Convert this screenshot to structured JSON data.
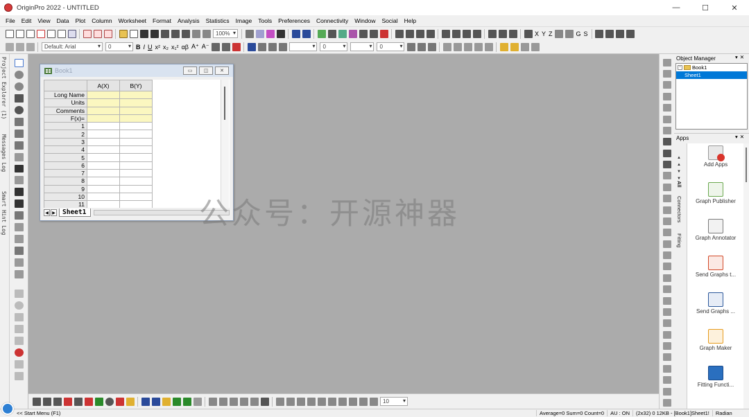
{
  "window": {
    "title": "OriginPro 2022 - UNTITLED",
    "controls": [
      "—",
      "☐",
      "✕"
    ]
  },
  "menu": [
    "File",
    "Edit",
    "View",
    "Data",
    "Plot",
    "Column",
    "Worksheet",
    "Format",
    "Analysis",
    "Statistics",
    "Image",
    "Tools",
    "Preferences",
    "Connectivity",
    "Window",
    "Social",
    "Help"
  ],
  "toolbar": {
    "zoom": "100%",
    "font_name": "Default: Arial",
    "font_size": "0",
    "line_width": "0",
    "line_width2": "0",
    "text_buttons": [
      "B",
      "I",
      "U",
      "x²",
      "x₂",
      "x₁²",
      "αβ",
      "A⁺",
      "A⁻"
    ],
    "xyz_buttons": [
      "X",
      "Y",
      "Z",
      "G",
      "S"
    ]
  },
  "left_tabs": [
    "Project Explorer (1)",
    "Messages Log",
    "Smart Hint Log"
  ],
  "workspace": {
    "watermark": "公众号：开源神器"
  },
  "workbook": {
    "title": "Book1",
    "ctrl_buttons": [
      "▭",
      "◫",
      "✕"
    ],
    "columns": [
      "A(X)",
      "B(Y)"
    ],
    "label_rows": [
      "Long Name",
      "Units",
      "Comments",
      "F(x)="
    ],
    "row_numbers": [
      "1",
      "2",
      "3",
      "4",
      "5",
      "6",
      "7",
      "8",
      "9",
      "10",
      "11"
    ],
    "sheet_tab": "Sheet1"
  },
  "bottom_toolbar": {
    "combo": "10"
  },
  "object_manager": {
    "title": "Object Manager",
    "tree": [
      {
        "label": "Book1",
        "selected": false
      },
      {
        "label": "Sheet1",
        "selected": true
      }
    ]
  },
  "apps_panel": {
    "title": "Apps",
    "vtabs": [
      "All",
      "Connectors",
      "Fitting"
    ],
    "items": [
      {
        "label": "Add Apps",
        "icon": "add-apps-icon",
        "color": "#d9342b"
      },
      {
        "label": "Graph Publisher",
        "icon": "graph-publisher-icon",
        "color": "#6aa84f"
      },
      {
        "label": "Graph Annotator",
        "icon": "graph-annotator-icon",
        "color": "#7a7a7a"
      },
      {
        "label": "Send Graphs t...",
        "icon": "send-ppt-icon",
        "color": "#d24726"
      },
      {
        "label": "Send Graphs ...",
        "icon": "send-word-icon",
        "color": "#2b579a"
      },
      {
        "label": "Graph Maker",
        "icon": "graph-maker-icon",
        "color": "#e69a1c"
      },
      {
        "label": "Fitting Functi...",
        "icon": "fitting-functions-icon",
        "color": "#2a6fbf"
      }
    ]
  },
  "status": {
    "start_menu": "<< Start Menu (F1)",
    "stats": "Average=0 Sum=0 Count=0",
    "au": "AU : ON",
    "sheet_info": "(2x32) 0  12KB - [Book1]Sheet1!",
    "angle": "Radian"
  }
}
